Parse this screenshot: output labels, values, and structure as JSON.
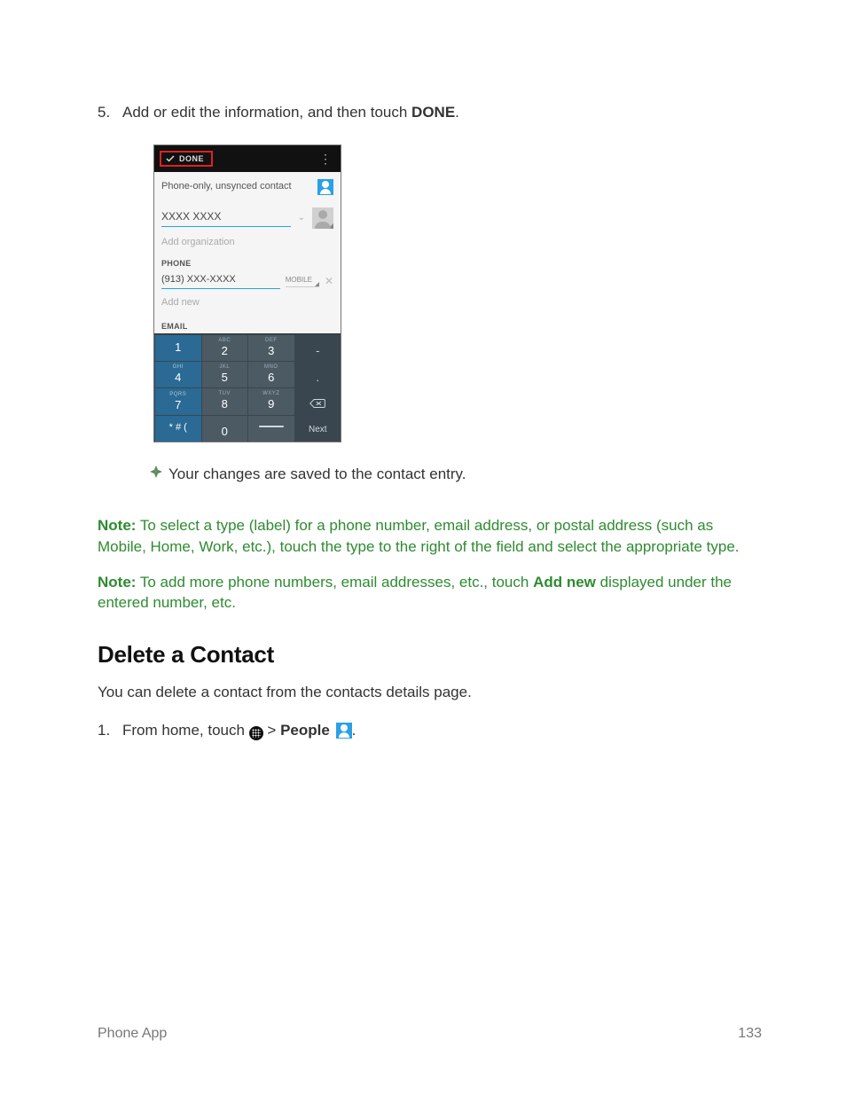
{
  "step5": {
    "number": "5.",
    "text_prefix": "Add or edit the information, and then touch ",
    "done": "DONE",
    "text_suffix": "."
  },
  "screenshot": {
    "done_button": "DONE",
    "account_type": "Phone-only, unsynced contact",
    "name_value": "XXXX XXXX",
    "add_org": "Add organization",
    "section_phone": "PHONE",
    "phone_value": "(913) XXX-XXXX",
    "phone_type": "MOBILE",
    "add_new": "Add new",
    "section_email": "EMAIL",
    "keys": {
      "k1": "1",
      "k2": "2",
      "k2s": "ABC",
      "k3": "3",
      "k3s": "DEF",
      "k4": "4",
      "k4s": "GHI",
      "k5": "5",
      "k5s": "JKL",
      "k6": "6",
      "k6s": "MNO",
      "k7": "7",
      "k7s": "PQRS",
      "k8": "8",
      "k8s": "TUV",
      "k9": "9",
      "k9s": "WXYZ",
      "sym": "* # (",
      "k0": "0",
      "next": "Next",
      "dash": "-",
      "dot": ".",
      "comma": ","
    }
  },
  "bullet_result": "Your changes are saved to the contact entry.",
  "note1": {
    "label": "Note:",
    "text": " To select a type (label) for a phone number, email address, or postal address (such as Mobile, Home, Work, etc.), touch the type to the right of the field and select the appropriate type."
  },
  "note2": {
    "label": "Note:",
    "prefix": " To add more phone numbers, email addresses, etc., touch ",
    "add_new": "Add new",
    "suffix": " displayed under the entered number, etc."
  },
  "heading_delete": "Delete a Contact",
  "delete_intro": "You can delete a contact from the contacts details page.",
  "step1": {
    "number": "1.",
    "prefix": "From home, touch ",
    "gt": ">",
    "people": "People",
    "suffix": "."
  },
  "footer": {
    "left": "Phone App",
    "right": "133"
  }
}
